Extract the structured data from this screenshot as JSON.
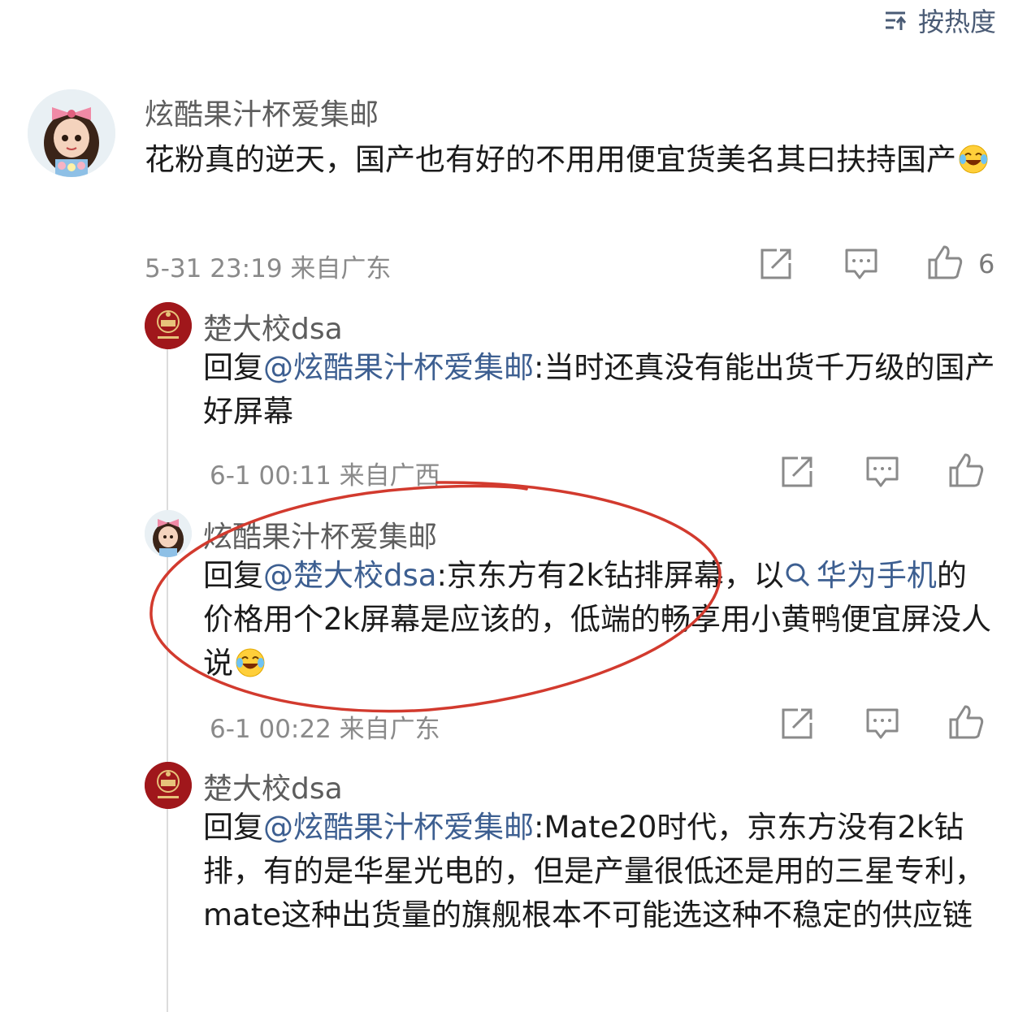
{
  "sort": {
    "label": "按热度",
    "icon": "sort-icon"
  },
  "comments": [
    {
      "author": "炫酷果汁杯爱集邮",
      "text": "花粉真的逆天，国产也有好的不用用便宜货美名其曰扶持国产",
      "time": "5-31 23:19 来自广东",
      "likes": "6"
    }
  ],
  "replies": [
    {
      "author": "楚大校dsa",
      "prefix": "回复",
      "mention": "@炫酷果汁杯爱集邮",
      "text": ":当时还真没有能出货千万级的国产好屏幕",
      "time": "6-1 00:11 来自广西"
    },
    {
      "author": "炫酷果汁杯爱集邮",
      "prefix": "回复",
      "mention": "@楚大校dsa",
      "text_a": ":京东方有2k钻排屏幕，以",
      "search_link": "华为手机",
      "text_b": "的价格用个2k屏幕是应该的，低端的畅享用小黄鸭便宜屏没人说",
      "time": "6-1 00:22 来自广东"
    },
    {
      "author": "楚大校dsa",
      "prefix": "回复",
      "mention": "@炫酷果汁杯爱集邮",
      "text": ":Mate20时代，京东方没有2k钻排，有的是华星光电的，但是产量很低还是用的三星专利，mate这种出货量的旗舰根本不可能选这种不稳定的供应链"
    }
  ],
  "colors": {
    "link": "#3d5f91",
    "annotation": "#d23a2e",
    "meta": "#8a8a8a"
  }
}
